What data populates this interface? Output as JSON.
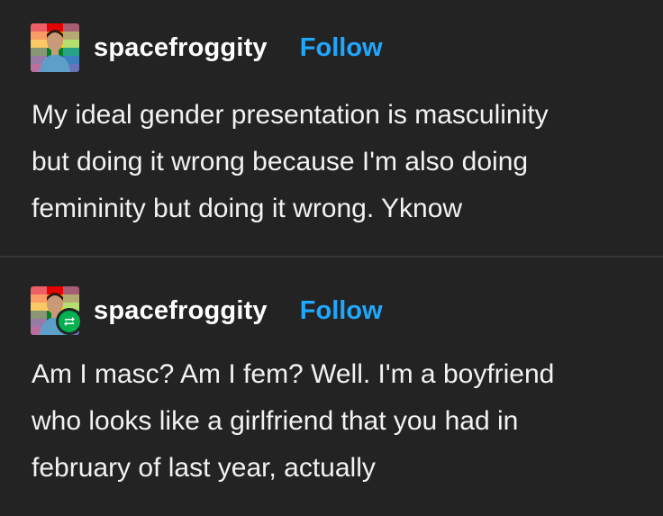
{
  "posts": [
    {
      "username": "spacefroggity",
      "follow_label": "Follow",
      "avatar_icon": "avatar-icon",
      "lines": [
        "My ideal gender presentation is masculinity",
        "but doing it wrong because I'm also doing",
        "femininity but doing it wrong. Yknow"
      ]
    },
    {
      "username": "spacefroggity",
      "follow_label": "Follow",
      "avatar_icon": "avatar-icon",
      "badge_icon": "reblog-icon",
      "lines": [
        "Am I masc? Am I fem? Well. I'm a boyfriend",
        "who looks like a girlfriend that you had in",
        "february of last year, actually"
      ]
    }
  ],
  "colors": {
    "background": "#232323",
    "text": "#f2f2f2",
    "follow": "#1ea8ff",
    "reblog_badge": "#00b14f",
    "divider": "#343434"
  }
}
